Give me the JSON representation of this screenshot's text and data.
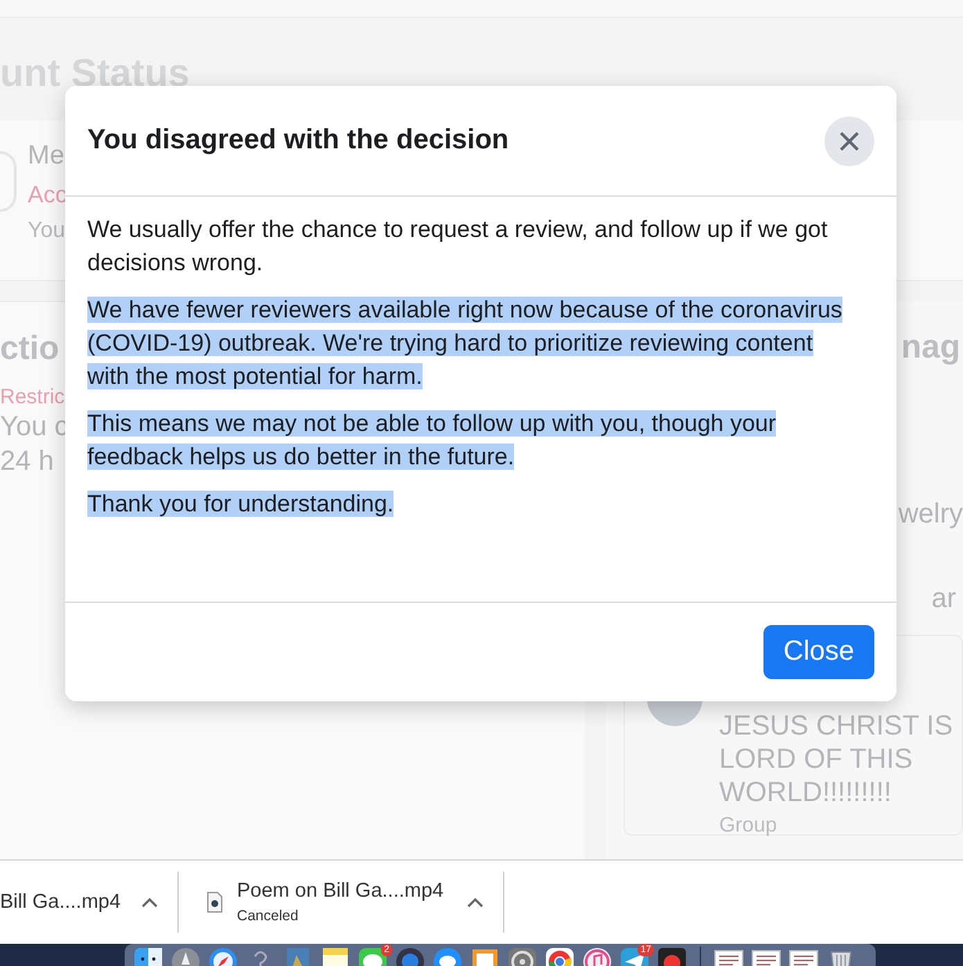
{
  "background": {
    "heading": "unt Status",
    "status_card": {
      "title": "Me",
      "status": "Acc",
      "text": "You"
    },
    "actions_card": {
      "title": "ctio",
      "label": "Restric",
      "lines": [
        "You c",
        "24 h"
      ]
    },
    "side_card": {
      "title": "nag",
      "items": [
        "welry",
        "ar"
      ],
      "group": {
        "name": "JESUS CHRIST IS LORD OF THIS WORLD!!!!!!!!!",
        "type": "Group"
      }
    }
  },
  "dialog": {
    "title": "You disagreed with the decision",
    "paragraphs": [
      {
        "text": "We usually offer the chance to request a review, and follow up if we got decisions wrong.",
        "selected": false
      },
      {
        "text": "We have fewer reviewers available right now because of the coronavirus (COVID-19) outbreak. We're trying hard to prioritize reviewing content with the most potential for harm.",
        "selected": true
      },
      {
        "text": "This means we may not be able to follow up with you, though your feedback helps us do better in the future.",
        "selected": true
      },
      {
        "text": "Thank you for understanding.",
        "selected": true
      }
    ],
    "button": "Close"
  },
  "downloads": [
    {
      "name": "Bill Ga....mp4"
    },
    {
      "name": "Poem on Bill Ga....mp4",
      "status": "Canceled"
    }
  ],
  "dock": {
    "apps": [
      {
        "kind": "finder"
      },
      {
        "kind": "rocket"
      },
      {
        "kind": "compass"
      },
      {
        "kind": "question"
      },
      {
        "kind": "preview"
      },
      {
        "kind": "notes"
      },
      {
        "kind": "messages",
        "badge": "2"
      },
      {
        "kind": "player"
      },
      {
        "kind": "chat"
      },
      {
        "kind": "pages"
      },
      {
        "kind": "gear"
      },
      {
        "kind": "chrome"
      },
      {
        "kind": "music"
      },
      {
        "kind": "plane",
        "badge": "17"
      },
      {
        "kind": "rec"
      },
      {
        "kind": "separator"
      },
      {
        "kind": "doc"
      },
      {
        "kind": "doc"
      },
      {
        "kind": "doc"
      },
      {
        "kind": "trash"
      }
    ]
  }
}
